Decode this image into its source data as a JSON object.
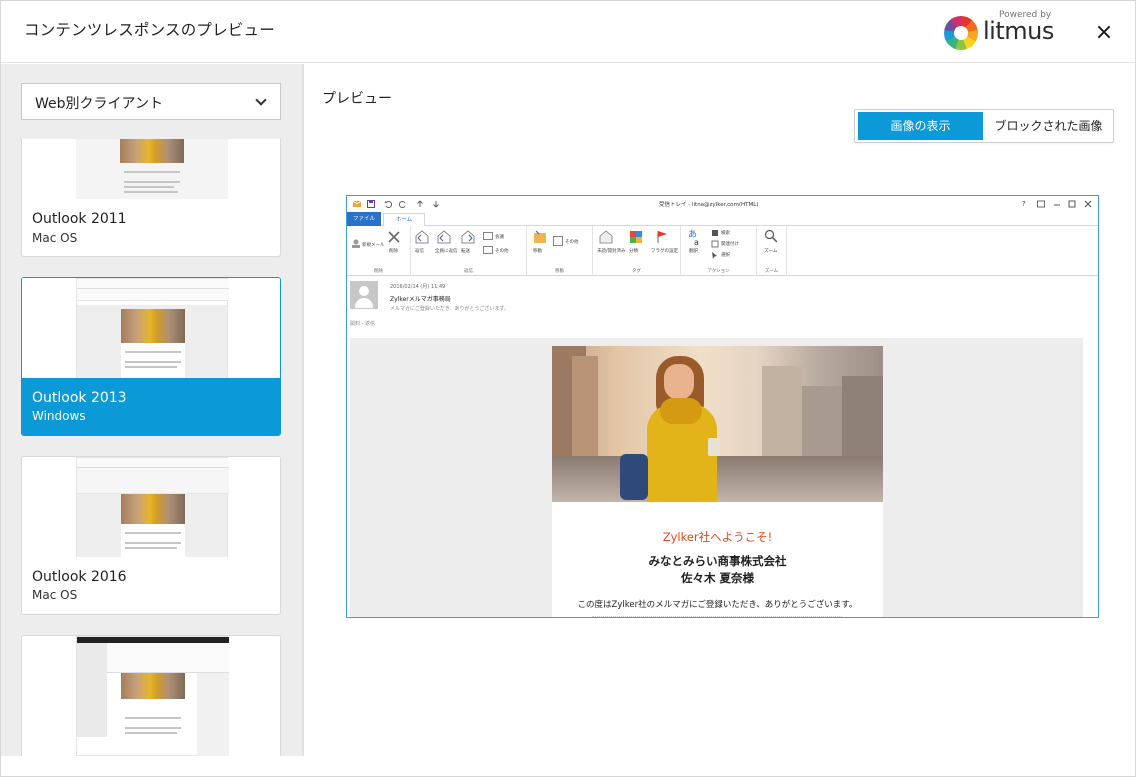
{
  "dialog": {
    "title": "コンテンツレスポンスのプレビュー",
    "powered_by": "Powered by",
    "brand": "litmus"
  },
  "sidebar": {
    "client_select": "Web別クライアント",
    "cards": [
      {
        "name": "Outlook 2011",
        "os": "Mac OS",
        "active": false
      },
      {
        "name": "Outlook 2013",
        "os": "Windows",
        "active": true
      },
      {
        "name": "Outlook 2016",
        "os": "Mac OS",
        "active": false
      },
      {
        "name": "",
        "os": "",
        "active": false
      }
    ]
  },
  "main": {
    "title": "プレビュー",
    "toggle": {
      "show_images": "画像の表示",
      "blocked_images": "ブロックされた画像"
    }
  },
  "outlook": {
    "window_title": "受信トレイ - litna@zylker.com(HTML)",
    "tab_file": "ファイル",
    "tab_home": "ホーム",
    "ribbon": {
      "new_mail": "新規メール",
      "delete": "削除",
      "reply": "返信",
      "reply_all": "全員に返信",
      "forward": "転送",
      "meeting": "会議",
      "more": "その他",
      "move": "移動",
      "rules": "その他",
      "read_unread": "未読/開封済み",
      "categorize": "分類",
      "followup": "フラグの設定",
      "translate": "翻訳",
      "search": "検索",
      "related": "関連付け",
      "select": "選択",
      "zoom": "ズーム",
      "group_delete": "削除",
      "group_respond": "返信",
      "group_move": "移動",
      "group_tags": "タグ",
      "group_actions": "アクション",
      "group_zoom": "ズーム"
    },
    "message": {
      "date": "2016/02/14 (月) 11:49",
      "from": "Zylkerメルマガ事務局",
      "subject": "メルマガにご登録いただき、ありがとうございます。",
      "note": "開封 - 返信"
    }
  },
  "email": {
    "welcome": "Zylker社へようこそ!",
    "company": "みなとみらい商事株式会社",
    "recipient": "佐々木 夏奈様",
    "body": "この度はZylker社のメルマガにご登録いただき、ありがとうございます。"
  },
  "colors": {
    "accent": "#0b99d8",
    "welcome_text": "#e24a1e",
    "outlook_blue": "#2a72c9"
  }
}
